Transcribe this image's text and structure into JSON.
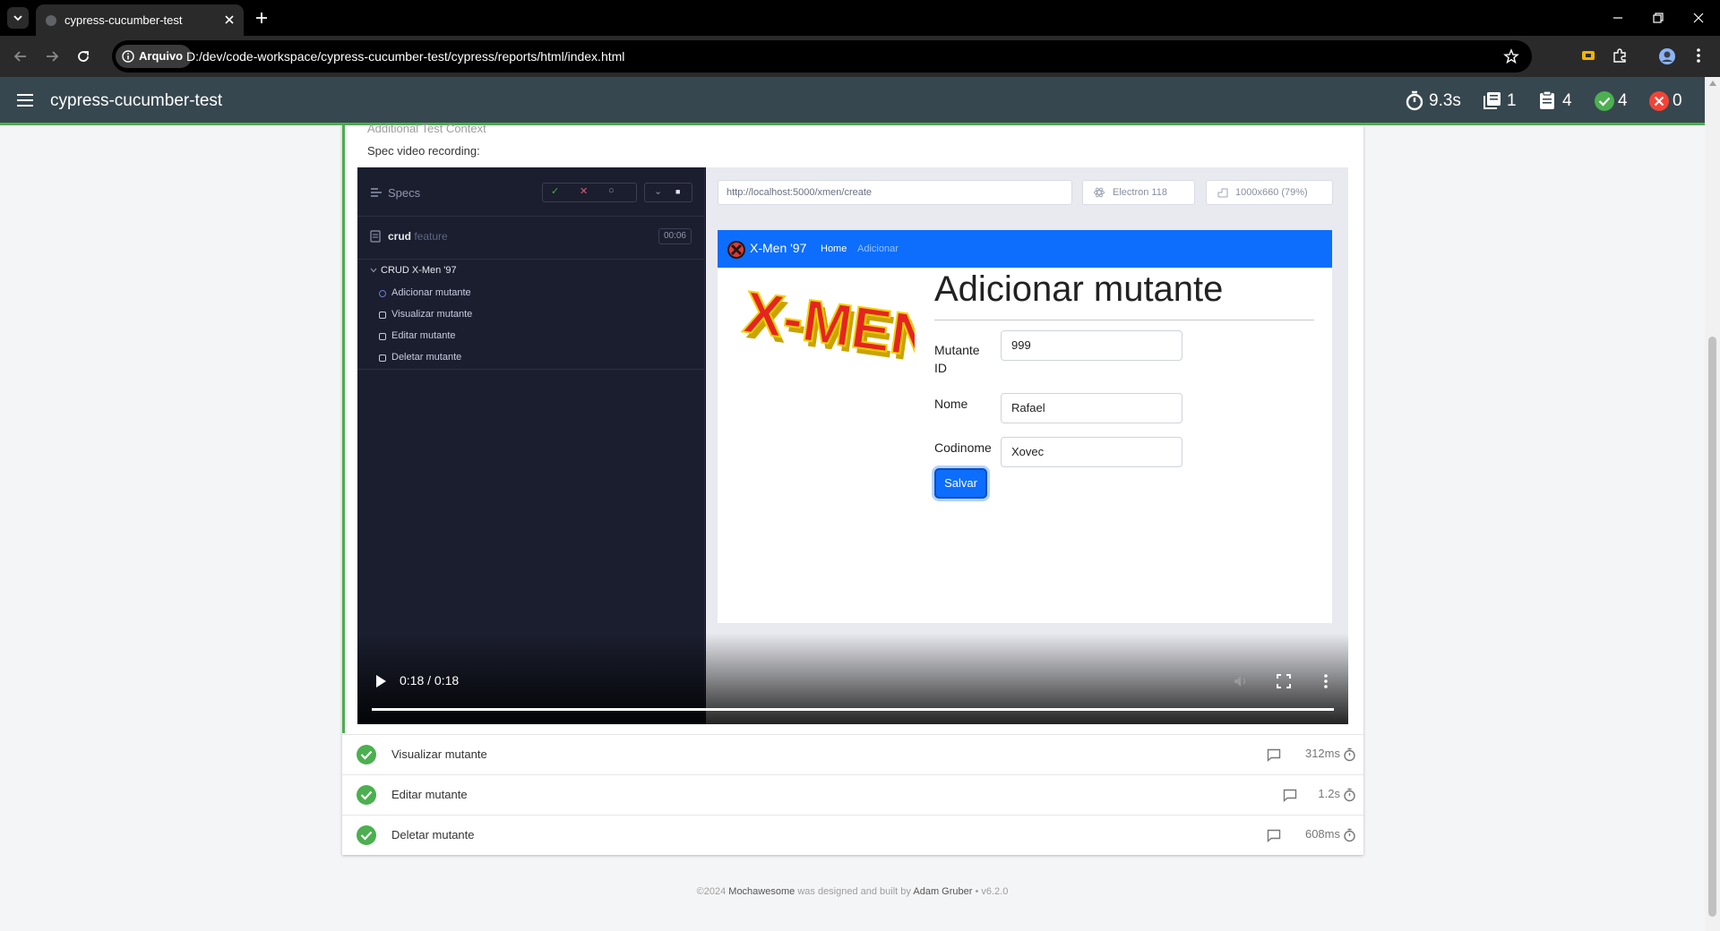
{
  "browser": {
    "tab_title": "cypress-cucumber-test",
    "site_chip": "Arquivo",
    "url": "D:/dev/code-workspace/cypress-cucumber-test/cypress/reports/html/index.html"
  },
  "navbar": {
    "title": "cypress-cucumber-test",
    "stats": {
      "duration": "9.3s",
      "suites": "1",
      "tests": "4",
      "passes": "4",
      "failures": "0"
    }
  },
  "context": {
    "heading": "Additional Test Context",
    "label": "Spec video recording:"
  },
  "runner": {
    "specs_label": "Specs",
    "spec_file": "crud",
    "spec_ext": "feature",
    "timer": "00:06",
    "suite": "CRUD X-Men '97",
    "tests": [
      "Adicionar mutante",
      "Visualizar mutante",
      "Editar mutante",
      "Deletar mutante"
    ],
    "url": "http://localhost:5000/xmen/create",
    "browser": "Electron 118",
    "viewport": "1000x660  (79%)"
  },
  "app": {
    "brand": "X-Men '97",
    "nav_home": "Home",
    "nav_add": "Adicionar",
    "logo_text": "X-MEN",
    "heading": "Adicionar mutante",
    "fields": [
      {
        "label": "Mutante ID",
        "value": "999"
      },
      {
        "label": "Nome",
        "value": "Rafael"
      },
      {
        "label": "Codinome",
        "value": "Xovec"
      }
    ],
    "save_label": "Salvar"
  },
  "video": {
    "time": "0:18 / 0:18",
    "progress": 1.0
  },
  "test_rows": [
    {
      "name": "Visualizar mutante",
      "duration": "312ms"
    },
    {
      "name": "Editar mutante",
      "duration": "1.2s"
    },
    {
      "name": "Deletar mutante",
      "duration": "608ms"
    }
  ],
  "footer": {
    "copyright": "©2024",
    "brand": "Mochawesome",
    "middle": "was designed and built by",
    "author": "Adam Gruber",
    "version": "• v6.2.0"
  },
  "colors": {
    "navbar": "#37474f",
    "pass": "#4caf50",
    "fail": "#f44336",
    "app_nav": "#0d6efd"
  }
}
